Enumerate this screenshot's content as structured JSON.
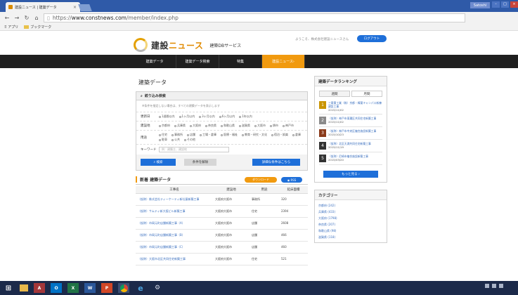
{
  "browser": {
    "tab_title": "建設ニュース | 建築データ",
    "tab_close": "×",
    "user_badge": "Satoshi",
    "url_scheme": "https://",
    "url_host": "www.constnews.com",
    "url_path": "/member/index.php",
    "bookmarks": [
      "アプリ",
      "ブックマーク"
    ]
  },
  "site": {
    "logo_main": "建設",
    "logo_accent": "ニュース",
    "logo_sub": "建築DBサービス",
    "welcome": "ようこそ、株式会社建設ニュースさん",
    "logout": "ログアウト",
    "nav": [
      {
        "label": "建築データ",
        "active": false
      },
      {
        "label": "建築データ検索",
        "active": false
      },
      {
        "label": "特集",
        "active": false
      },
      {
        "label": "建設ニュース",
        "active": true
      }
    ]
  },
  "main": {
    "title": "建築データ",
    "filter": {
      "heading": "絞り込み検索",
      "note": "※条件を指定しない場合は、すべての建築データを表示します",
      "updated_label": "更新日",
      "updated_opts": [
        "1週間以内",
        "1ヶ月以内",
        "3ヶ月以内",
        "6ヶ月以内",
        "1年以内"
      ],
      "area_label": "建設地",
      "area_opts": [
        "京都府",
        "兵庫県",
        "大阪府",
        "奈良県",
        "和歌山県",
        "滋賀県",
        "大阪市",
        "堺市",
        "神戸市"
      ],
      "use_label": "用途",
      "use_opts": [
        "住宅",
        "事務所",
        "店舗",
        "工場・倉庫",
        "医療・福祉",
        "教育・研究・文化",
        "宿泊・娯楽",
        "倉庫",
        "駐車",
        "公共",
        "その他"
      ],
      "keyword_label": "キーワード",
      "keyword_placeholder": "例：建築主、建設地",
      "search_btn": "検索",
      "clear_btn": "条件を解除",
      "advanced_btn": "詳細な条件はこちら"
    },
    "newdata": {
      "title": "新着 建築データ",
      "download_btn": "ダウンロード",
      "rss_btn": "RSS",
      "columns": [
        "工事名",
        "建設地",
        "用途",
        "延床面積"
      ],
      "rows": [
        {
          "name": "（仮称）株式会社ティーケーティ新社屋新築工事",
          "place": "大阪府大阪市",
          "use": "事務所",
          "area": "320"
        },
        {
          "name": "（仮称）サムティ新大阪ビル新築工事",
          "place": "大阪府大阪市",
          "use": "住宅",
          "area": "2394"
        },
        {
          "name": "（仮称）市岡元町店舗新築工事（A）",
          "place": "大阪府大阪市",
          "use": "店舗",
          "area": "2608"
        },
        {
          "name": "（仮称）市岡元町店舗新築工事（B）",
          "place": "大阪府大阪市",
          "use": "店舗",
          "area": "466"
        },
        {
          "name": "（仮称）市岡元町店舗新築工事（C）",
          "place": "大阪府大阪市",
          "use": "店舗",
          "area": "460"
        },
        {
          "name": "（仮称）大阪市北区共同住宅新築工事",
          "place": "大阪府大阪市",
          "use": "住宅",
          "area": "521"
        }
      ]
    }
  },
  "sidebar": {
    "ranking_title": "建築データランキング",
    "tabs": [
      "週間",
      "月間"
    ],
    "ranking": [
      {
        "num": "1",
        "color": "#c99400",
        "text": "三菱重工業（株）京都・樟葉キャンパス新棟建設工事",
        "date": "2015/11/02"
      },
      {
        "num": "2",
        "color": "#8a8a8a",
        "text": "（仮称）神戸市東灘区共同住宅新築工事",
        "date": "2015/11/02"
      },
      {
        "num": "3",
        "color": "#8a3a1a",
        "text": "（仮称）神戸市中央区複合施設新築工事",
        "date": "2015/10/23"
      },
      {
        "num": "4",
        "color": "#333333",
        "text": "（仮称）北区天満共同住宅新築工事",
        "date": "2015/11/19"
      },
      {
        "num": "5",
        "color": "#333333",
        "text": "（仮称）尼崎市複合施設新築工事",
        "date": "2015/03/20"
      }
    ],
    "more_btn": "もっと見る",
    "category_title": "カテゴリー",
    "categories": [
      "京都府 (242)",
      "兵庫県 (433)",
      "大阪府 (1798)",
      "奈良県 (207)",
      "和歌山県 (98)",
      "滋賀県 (118)"
    ]
  },
  "taskbar": {
    "items": [
      "A",
      "O",
      "X",
      "W",
      "P"
    ]
  }
}
